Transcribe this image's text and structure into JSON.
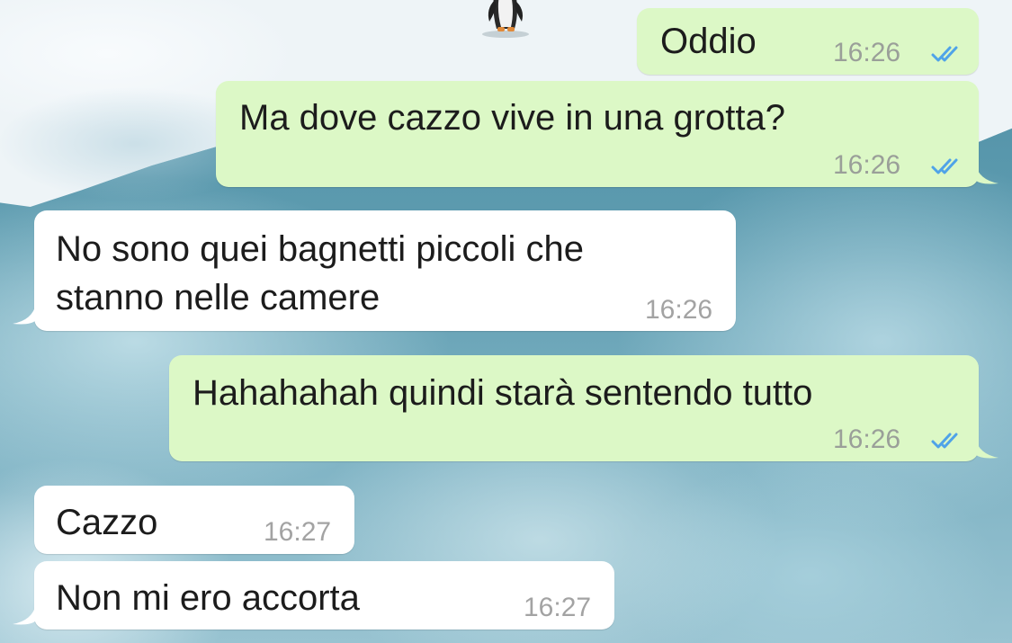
{
  "messages": [
    {
      "direction": "out",
      "text": "Oddio",
      "time": "16:26",
      "status": "read"
    },
    {
      "direction": "out",
      "text": "Ma dove cazzo vive in una grotta?",
      "time": "16:26",
      "status": "read"
    },
    {
      "direction": "in",
      "lines": [
        "No sono quei bagnetti piccoli che",
        "stanno nelle camere"
      ],
      "time": "16:26"
    },
    {
      "direction": "out",
      "text": "Hahahahah quindi starà sentendo tutto",
      "time": "16:26",
      "status": "read"
    },
    {
      "direction": "in",
      "text": "Cazzo",
      "time": "16:27"
    },
    {
      "direction": "in",
      "text": "Non mi ero accorta",
      "time": "16:27"
    }
  ],
  "colors": {
    "outgoing_bubble": "#dcf8c6",
    "incoming_bubble": "#ffffff",
    "read_ticks": "#4fa3e8",
    "timestamp": "#9a9f99"
  },
  "icons": {
    "read_receipt": "double-check-icon",
    "wallpaper_figure": "penguin"
  }
}
